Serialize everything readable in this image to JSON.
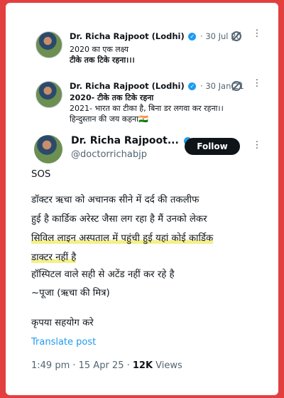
{
  "quoted_posts": [
    {
      "name": "Dr. Richa Rajpoot (Lodhi)",
      "date": "· 30 Jul 20",
      "lines": [
        "2020 का एक लक्ष्य",
        "टीके तक टिके रहना।।।"
      ]
    },
    {
      "name": "Dr. Richa Rajpoot (Lodhi)",
      "date": "· 30 Jan 21",
      "lines": [
        "2020- टीके तक टिके रहना",
        "2021- भारत का टीका है, बिना डर लगवा कर रहना।।",
        "हिन्दुस्तान की जय कहना🇮🇳"
      ]
    }
  ],
  "main_post": {
    "name": "Dr. Richa Rajpoot...",
    "handle": "@doctorrichabjp",
    "follow_label": "Follow",
    "text_lines": [
      "SOS",
      "डॉक्टर ऋचा को अचानक सीने में दर्द की तकलीफ",
      "हुई है कार्डिक अरेस्ट जैसा लग रहा है मैं उनको लेकर",
      "सिविल लाइन अस्पताल में पहुंची हुई यहां कोई कार्डिक",
      "डाक्टर नहीं है",
      "हॉस्पिटल वाले सही से अटेंड नहीं कर रहे है",
      "~पूजा (ऋचा की मित्र)",
      "कृपया सहयोग करे"
    ],
    "translate_label": "Translate post",
    "time": "1:49 pm · 15 Apr 25 · ",
    "views_count": "12K",
    "views_label": " Views"
  }
}
